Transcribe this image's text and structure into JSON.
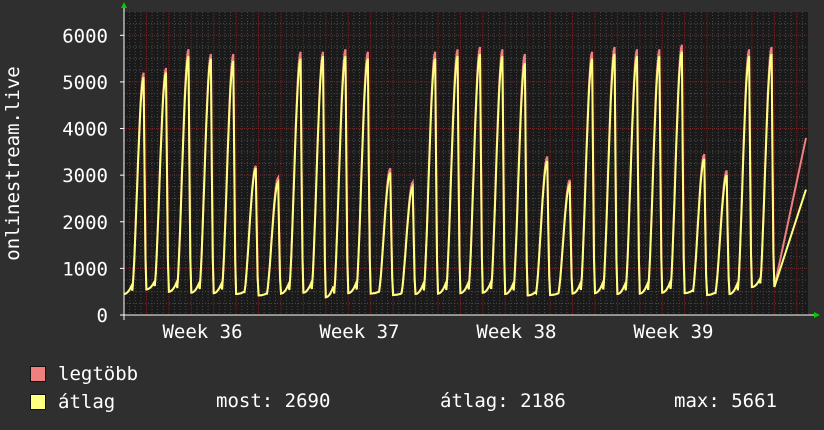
{
  "chart_data": {
    "type": "line",
    "ylabel": "onlinestream.live",
    "yticks": [
      0,
      1000,
      2000,
      3000,
      4000,
      5000,
      6000
    ],
    "ylim": [
      0,
      6500
    ],
    "x_tick_labels": [
      "Week 36",
      "Week 37",
      "Week 38",
      "Week 39"
    ],
    "x_tick_days": [
      3.5,
      10.5,
      17.5,
      24.5
    ],
    "x_range_days": [
      0,
      30.5
    ],
    "grid": true,
    "legend_position": "bottom-left",
    "daily_peaks_max": [
      5200,
      5300,
      5700,
      5600,
      5600,
      3200,
      2950,
      5650,
      5650,
      5700,
      5650,
      3150,
      2850,
      5650,
      5700,
      5750,
      5700,
      5600,
      3400,
      2900,
      5650,
      5750,
      5700,
      5700,
      5800,
      3450,
      3100,
      5700,
      5750
    ],
    "daily_peaks_avg": [
      5100,
      5200,
      5550,
      5500,
      5450,
      3150,
      2850,
      5500,
      5550,
      5550,
      5500,
      3050,
      2750,
      5500,
      5550,
      5600,
      5550,
      5400,
      3300,
      2800,
      5500,
      5600,
      5550,
      5550,
      5650,
      3350,
      3000,
      5550,
      5600
    ],
    "daily_troughs": [
      450,
      550,
      500,
      480,
      470,
      450,
      420,
      460,
      480,
      380,
      470,
      460,
      430,
      450,
      460,
      470,
      480,
      450,
      420,
      430,
      460,
      470,
      450,
      460,
      480,
      470,
      430,
      450,
      600
    ],
    "last_value_max": 3800,
    "last_value_avg": 2690,
    "series": [
      {
        "name": "legtöbb",
        "color": "#f08080"
      },
      {
        "name": "átlag",
        "color": "#ffff80"
      }
    ]
  },
  "legend": {
    "max_label": "legtöbb",
    "avg_label": "átlag",
    "max_color": "#f08080",
    "avg_color": "#ffff80"
  },
  "stats": {
    "now": "most: 2690",
    "avg": "átlag: 2186",
    "max": "max: 5661"
  },
  "colors": {
    "background": "#2f2f2f",
    "plot_background": "#1a1a1a",
    "grid_major": "#6a2a2a",
    "grid_minor": "#4a4a4a",
    "axis_arrow": "#00cc00"
  }
}
